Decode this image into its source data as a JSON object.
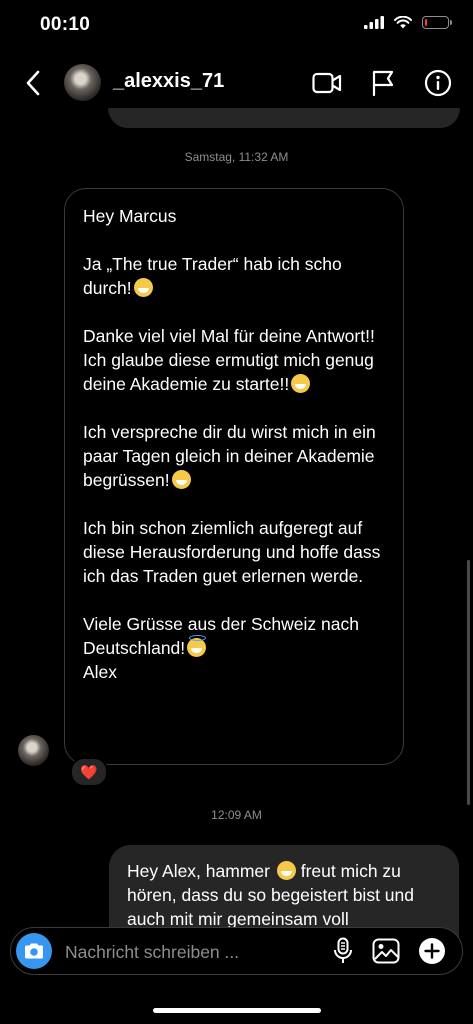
{
  "status_bar": {
    "time": "00:10",
    "battery_level": 0.1,
    "battery_color": "#ff3b30"
  },
  "header": {
    "username": "_alexxis_71",
    "icons": [
      "back-chevron-icon",
      "video-call-icon",
      "flag-icon",
      "info-icon"
    ]
  },
  "conversation": {
    "timestamp_1": "Samstag, 11:32 AM",
    "incoming_message": {
      "greeting": "Hey Marcus",
      "p1": "Ja „The true Trader“ hab ich scho durch!",
      "p2": "Danke viel viel Mal für deine Antwort!! Ich glaube diese ermutigt mich genug deine Akademie zu starte!!",
      "p3": "Ich verspreche dir du wirst mich in ein paar Tagen gleich in deiner Akademie begrüssen!",
      "p4": "Ich bin schon ziemlich aufgeregt auf diese Herausforderung und hoffe dass ich das Traden guet erlernen werde.",
      "p5": "Viele Grüsse aus der Schweiz nach Deutschland!",
      "signoff": "Alex",
      "reaction": "❤️"
    },
    "timestamp_2": "12:09 AM",
    "outgoing_message": {
      "part1": "Hey Alex, hammer",
      "part2": "freut mich zu hören, dass du so begeistert bist und auch mit mir gemeinsam voll"
    }
  },
  "composer": {
    "placeholder": "Nachricht schreiben ...",
    "icons": [
      "camera-icon",
      "microphone-icon",
      "gallery-icon",
      "plus-icon"
    ],
    "camera_color": "#3797f0"
  }
}
